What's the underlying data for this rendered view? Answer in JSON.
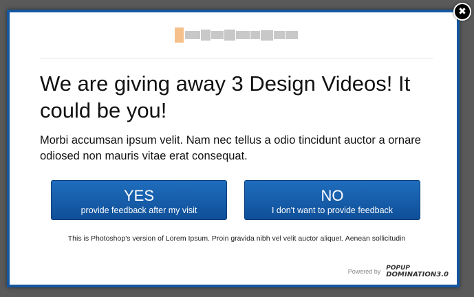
{
  "popup": {
    "headline": "We are giving away 3 Design Videos! It could be you!",
    "subtext": "Morbi accumsan ipsum velit. Nam nec tellus a odio tincidunt auctor a ornare odiosed non mauris vitae erat consequat.",
    "yes_button": {
      "label": "YES",
      "sublabel": "provide feedback after my visit"
    },
    "no_button": {
      "label": "NO",
      "sublabel": "I don't want to provide feedback"
    },
    "footnote": "This is Photoshop's version of Lorem Ipsum. Proin gravida nibh vel velit auctor aliquet. Aenean sollicitudin",
    "powered_by": "Powered by",
    "brand_top": "Popup",
    "brand_bottom": "Domination3.0",
    "close_symbol": "✖"
  },
  "colors": {
    "overlay": "#5a5a5a",
    "frame": "#1557a0",
    "button": "#1560ad"
  },
  "icons": [
    "close-icon",
    "blurred-logo"
  ]
}
